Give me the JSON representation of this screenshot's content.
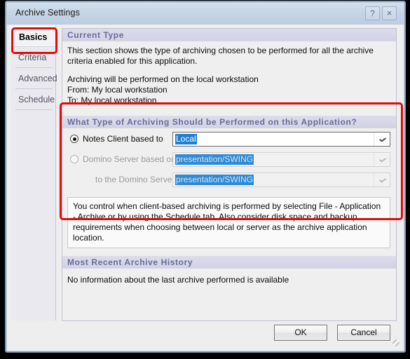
{
  "window": {
    "title": "Archive Settings",
    "help_label": "?",
    "close_label": "×"
  },
  "sidebar": {
    "items": [
      {
        "label": "Basics",
        "selected": true
      },
      {
        "label": "Criteria",
        "selected": false
      },
      {
        "label": "Advanced",
        "selected": false
      },
      {
        "label": "Schedule",
        "selected": false
      }
    ]
  },
  "sections": {
    "current_type": {
      "header": "Current Type",
      "paragraph1": "This section shows the type of archiving chosen to be performed for all the archive criteria enabled for this application.",
      "line1": "Archiving will be performed on the local workstation",
      "line2": "From: My local workstation",
      "line3": "To: My local workstation"
    },
    "archive_type": {
      "header": "What Type of Archiving Should be Performed on this Application?",
      "options": [
        {
          "label": "Notes Client based to",
          "selected": true,
          "enabled": true,
          "value": "Local"
        },
        {
          "label": "Domino Server based on",
          "selected": false,
          "enabled": false,
          "value": "presentation/SWING"
        },
        {
          "label": "to the Domino Server",
          "selected": null,
          "enabled": false,
          "value": "presentation/SWING"
        }
      ],
      "info_text": "You control when client-based archiving is performed by selecting File - Application - Archive or by using the Schedule tab.  Also consider disk space and backup requirements when choosing between local or server as the archive application location."
    },
    "history": {
      "header": "Most Recent Archive History",
      "text": "No information about the last archive performed is available"
    }
  },
  "footer": {
    "ok_label": "OK",
    "cancel_label": "Cancel"
  },
  "annotations": {
    "accent_color": "#e50b0b",
    "boxes": [
      {
        "name": "basics-tab-highlight"
      },
      {
        "name": "archive-type-section-highlight"
      }
    ]
  },
  "colors": {
    "titlebar": "#c6d5e6",
    "dialog_bg": "#eeeeee",
    "section_header_bg": "#d6d6e8",
    "section_header_text": "#6a6a9c",
    "selection_blue": "#1c7fd4",
    "annotation_red": "#e50b0b"
  }
}
